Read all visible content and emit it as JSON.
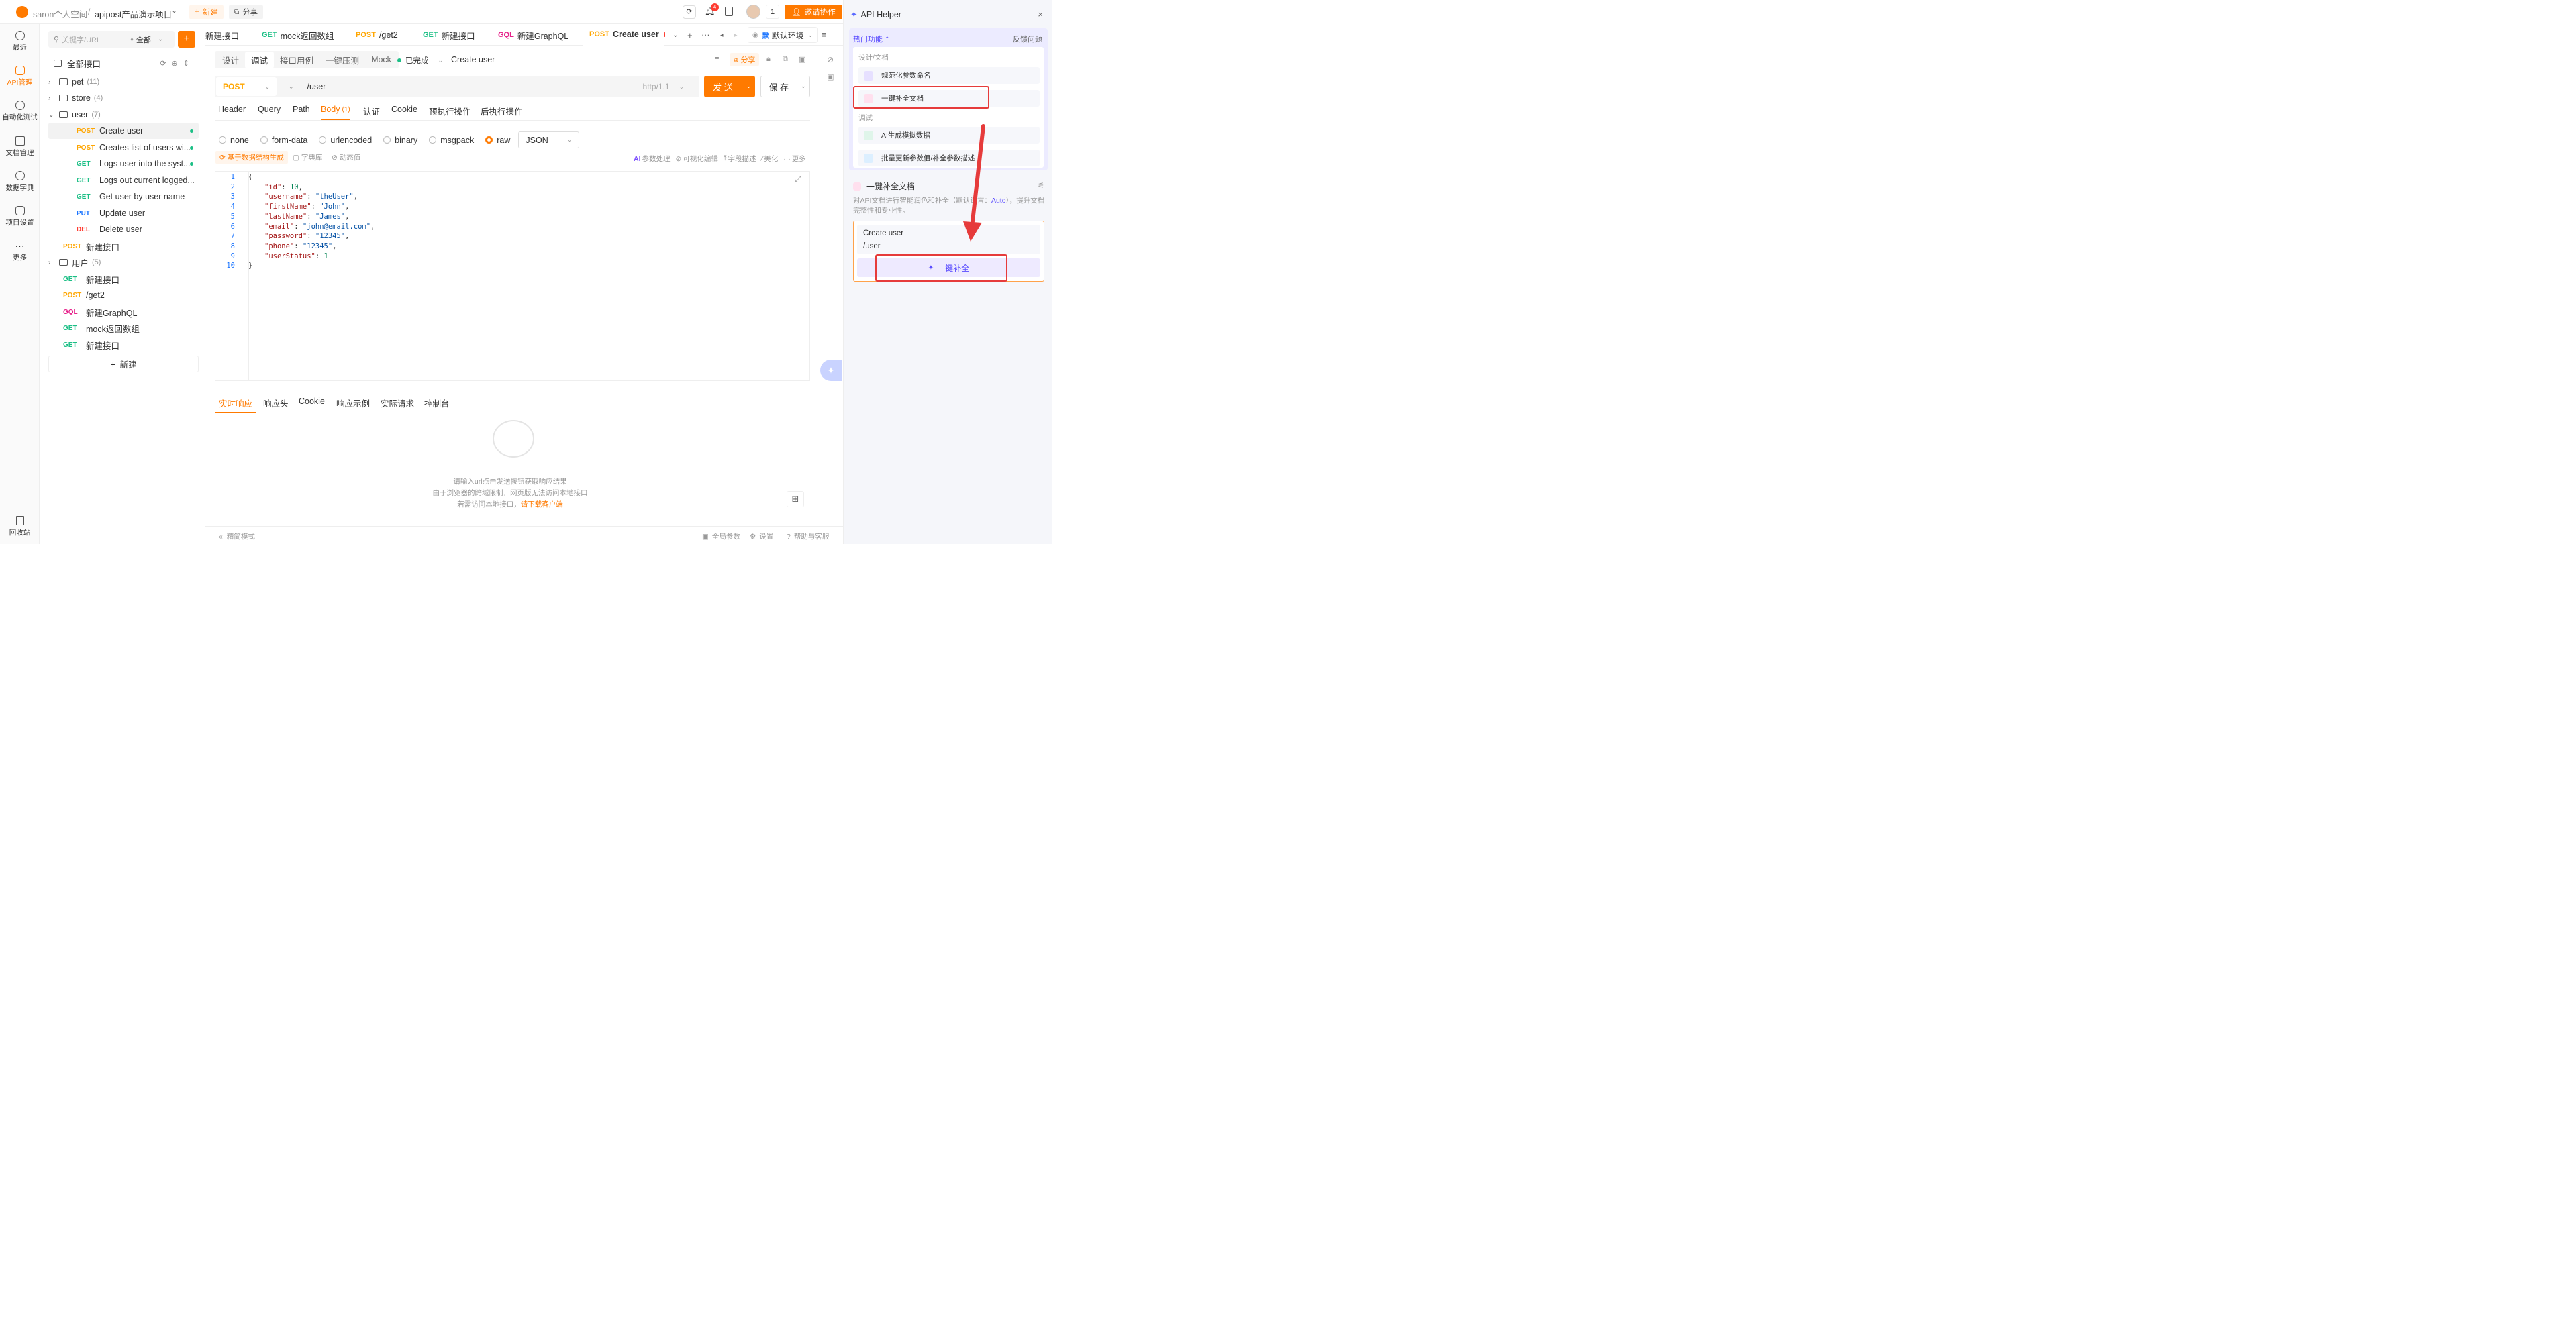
{
  "topbar": {
    "breadcrumb_space": "saron个人空间",
    "breadcrumb_sep": "/",
    "project_name": "apipost产品演示项目",
    "new_label": "新建",
    "share_label": "分享",
    "notif_count": "4",
    "user_count": "1",
    "invite_label": "邀请协作"
  },
  "leftnav": {
    "items": [
      {
        "label": "最近"
      },
      {
        "label": "API管理"
      },
      {
        "label": "自动化测试"
      },
      {
        "label": "文档管理"
      },
      {
        "label": "数据字典"
      },
      {
        "label": "项目设置"
      },
      {
        "label": "更多"
      },
      {
        "label": "回收站"
      }
    ]
  },
  "tree": {
    "search_placeholder": "关键字/URL",
    "filter_label": "全部",
    "root_label": "全部接口",
    "folders": [
      {
        "name": "pet",
        "count": "(11)"
      },
      {
        "name": "store",
        "count": "(4)"
      },
      {
        "name": "user",
        "count": "(7)"
      },
      {
        "name": "用户",
        "count": "(5)"
      }
    ],
    "user_items": [
      {
        "method": "POST",
        "name": "Create user"
      },
      {
        "method": "POST",
        "name": "Creates list of users wi..."
      },
      {
        "method": "GET",
        "name": "Logs user into the syst..."
      },
      {
        "method": "GET",
        "name": "Logs out current logged..."
      },
      {
        "method": "GET",
        "name": "Get user by user name"
      },
      {
        "method": "PUT",
        "name": "Update user"
      },
      {
        "method": "DEL",
        "name": "Delete user"
      }
    ],
    "post_new": {
      "method": "POST",
      "name": "新建接口"
    },
    "root_items": [
      {
        "method": "GET",
        "name": "新建接口"
      },
      {
        "method": "POST",
        "name": "/get2"
      },
      {
        "method": "GQL",
        "name": "新建GraphQL"
      },
      {
        "method": "GET",
        "name": "mock返回数组"
      },
      {
        "method": "GET",
        "name": "新建接口"
      }
    ],
    "new_button": "新建"
  },
  "tabs": [
    {
      "method": "",
      "name": "新建接口"
    },
    {
      "method": "GET",
      "name": "mock返回数组"
    },
    {
      "method": "POST",
      "name": "/get2"
    },
    {
      "method": "GET",
      "name": "新建接口"
    },
    {
      "method": "GQL",
      "name": "新建GraphQL"
    },
    {
      "method": "POST",
      "name": "Create user"
    }
  ],
  "env_label": "默认环境",
  "env_badge": "默",
  "mode_tabs": [
    "设计",
    "调试",
    "接口用例",
    "一键压测",
    "Mock"
  ],
  "status_label": "已完成",
  "api_name": "Create user",
  "share_label": "分享",
  "request": {
    "method": "POST",
    "url": "/user",
    "protocol": "http/1.1",
    "send_label": "发 送",
    "save_label": "保 存"
  },
  "param_tabs": {
    "header": "Header",
    "query": "Query",
    "path": "Path",
    "body": "Body",
    "body_count": "(1)",
    "auth": "认证",
    "cookie": "Cookie",
    "pre": "预执行操作",
    "post": "后执行操作"
  },
  "body_types": [
    "none",
    "form-data",
    "urlencoded",
    "binary",
    "msgpack",
    "raw"
  ],
  "body_format": "JSON",
  "body_tools_left": [
    "基于数据结构生成",
    "字典库",
    "动态值"
  ],
  "body_tools_right": {
    "ai": "AI",
    "param": "参数处理",
    "visual": "可视化编辑",
    "field": "字段描述",
    "beautify": "美化",
    "more": "更多"
  },
  "code_lines": [
    {
      "no": "1",
      "key": "",
      "val": "",
      "raw": "{"
    },
    {
      "no": "2",
      "key": "\"id\"",
      "val": "10",
      "type": "n"
    },
    {
      "no": "3",
      "key": "\"username\"",
      "val": "\"theUser\"",
      "type": "s"
    },
    {
      "no": "4",
      "key": "\"firstName\"",
      "val": "\"John\"",
      "type": "s"
    },
    {
      "no": "5",
      "key": "\"lastName\"",
      "val": "\"James\"",
      "type": "s"
    },
    {
      "no": "6",
      "key": "\"email\"",
      "val": "\"john@email.com\"",
      "type": "s"
    },
    {
      "no": "7",
      "key": "\"password\"",
      "val": "\"12345\"",
      "type": "s"
    },
    {
      "no": "8",
      "key": "\"phone\"",
      "val": "\"12345\"",
      "type": "s"
    },
    {
      "no": "9",
      "key": "\"userStatus\"",
      "val": "1",
      "type": "n"
    },
    {
      "no": "10",
      "key": "",
      "val": "",
      "raw": "}"
    }
  ],
  "response_tabs": [
    "实时响应",
    "响应头",
    "Cookie",
    "响应示例",
    "实际请求",
    "控制台"
  ],
  "response_empty": {
    "line1": "请输入url点击发送按钮获取响应结果",
    "line2": "由于浏览器的跨域限制，网页版无法访问本地接口",
    "line3_prefix": "若需访问本地接口，",
    "line3_link": "请下载客户端"
  },
  "footer": {
    "left": "精简模式",
    "global": "全局参数",
    "settings": "设置",
    "help": "帮助与客服"
  },
  "helper": {
    "title": "API Helper",
    "hot": "热门功能",
    "feedback": "反馈问题",
    "group1": "设计/文档",
    "item1": "规范化参数命名",
    "item2": "一键补全文档",
    "group2": "调试",
    "item3": "AI生成模拟数据",
    "item4": "批量更新参数值/补全参数描述",
    "section_title": "一键补全文档",
    "desc_pre": "对API文档进行智能润色和补全（默认语言：",
    "desc_auto": "Auto",
    "desc_post": "），提升文档完整性和专业性。",
    "input_line1": "Create user",
    "input_line2": "/user",
    "complete_button": "一键补全"
  }
}
